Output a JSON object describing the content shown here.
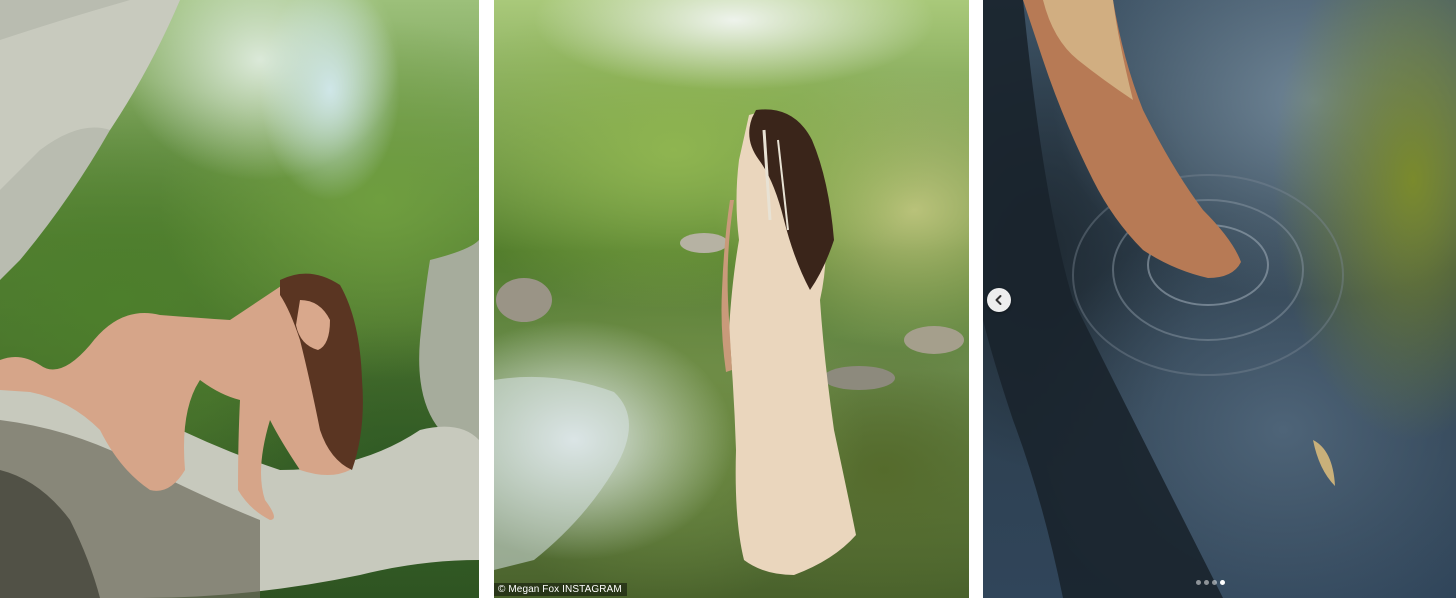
{
  "caption": "© Megan Fox INSTAGRAM",
  "photos": [
    {
      "scene": "woman crouching on tree branch in forest"
    },
    {
      "scene": "woman in lace dress standing in forest stream"
    },
    {
      "scene": "foot touching rippling water surface"
    }
  ],
  "carousel": {
    "previous_icon": "chevron-left-icon",
    "slide_count": 4,
    "active_slide": 4
  },
  "colors": {
    "page_background": "#ffffff",
    "button_background": "#ffffff",
    "dot_inactive": "rgba(255,255,255,0.5)",
    "dot_active": "#ffffff"
  }
}
